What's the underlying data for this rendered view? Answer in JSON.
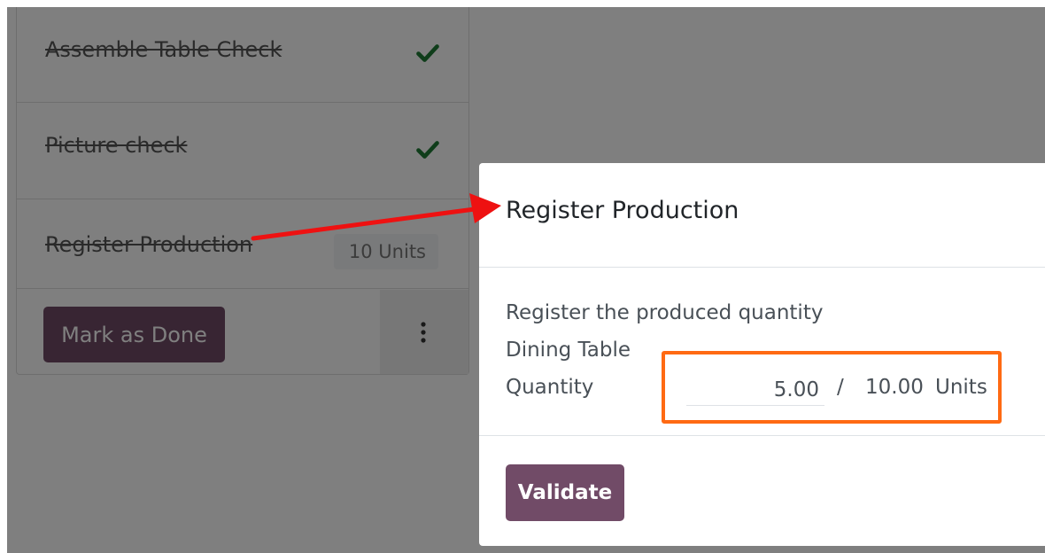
{
  "workorder": {
    "steps": [
      {
        "label": "Assemble Table Check",
        "done_icon": "check-icon"
      },
      {
        "label": "Picture check",
        "done_icon": "check-icon"
      },
      {
        "label": "Register Production",
        "quantity": "10 Units"
      }
    ],
    "mark_done_label": "Mark as Done",
    "more_icon": "vertical-ellipsis-icon"
  },
  "dialog": {
    "title": "Register Production",
    "instruction": "Register the produced quantity",
    "product": "Dining Table",
    "quantity_label": "Quantity",
    "quantity_value": "5.00",
    "separator": "/",
    "quantity_total": "10.00",
    "uom": "Units",
    "validate_label": "Validate"
  },
  "colors": {
    "primary": "#714b67",
    "check": "#1f7a35",
    "highlight_box": "#ff6a13",
    "arrow": "#ee1111",
    "overlay": "rgba(0,0,0,0.5)"
  }
}
